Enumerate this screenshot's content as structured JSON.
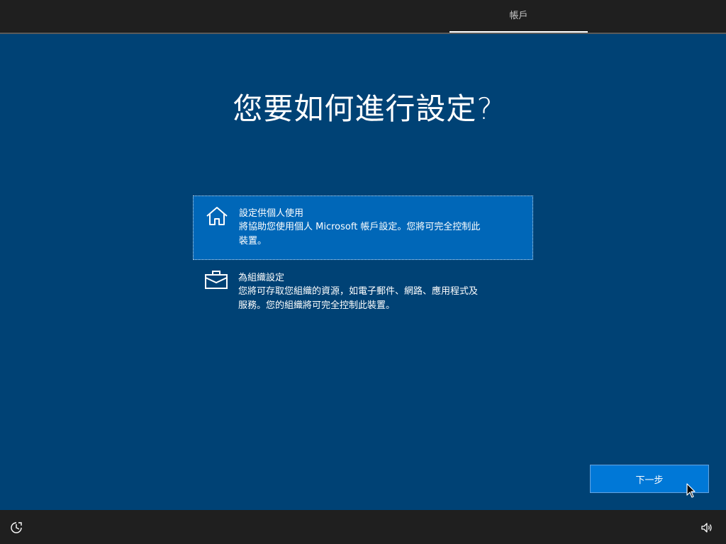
{
  "header": {
    "active_tab": "帳戶"
  },
  "main": {
    "title": "您要如何進行設定?",
    "options": [
      {
        "icon": "home-icon",
        "title": "設定供個人使用",
        "desc_line1": "將協助您使用個人 Microsoft 帳戶設定。您將可完全控制此",
        "desc_line2": "裝置。",
        "selected": true
      },
      {
        "icon": "briefcase-icon",
        "title": "為組織設定",
        "desc_line1": "您將可存取您組織的資源，如電子郵件、網路、應用程式及",
        "desc_line2": "服務。您的組織將可完全控制此裝置。",
        "selected": false
      }
    ],
    "next_label": "下一步"
  },
  "footer": {
    "left_icon": "ease-of-access-icon",
    "right_icon": "volume-icon"
  },
  "colors": {
    "background": "#004275",
    "selected_option": "#0067b8",
    "button": "#0078d7",
    "bars": "#1f1f1f"
  }
}
